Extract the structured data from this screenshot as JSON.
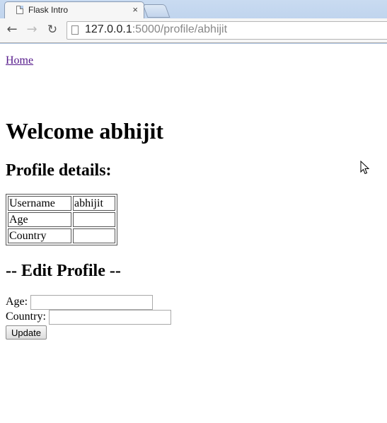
{
  "browser": {
    "tab_title": "Flask Intro",
    "tab_close": "×",
    "url_host": "127.0.0.1",
    "url_path": ":5000/profile/abhijit"
  },
  "page": {
    "home_link": "Home",
    "welcome": "Welcome abhijit",
    "profile_heading": "Profile details:",
    "table": [
      {
        "label": "Username",
        "value": "abhijit"
      },
      {
        "label": "Age",
        "value": ""
      },
      {
        "label": "Country",
        "value": ""
      }
    ],
    "edit_heading": "-- Edit Profile --",
    "form": {
      "age_label": "Age:",
      "age_value": "",
      "country_label": "Country:",
      "country_value": "",
      "update_label": "Update"
    }
  },
  "icons": {
    "back": "arrow-left-icon",
    "forward": "arrow-right-icon",
    "reload": "reload-icon",
    "page": "page-icon"
  }
}
